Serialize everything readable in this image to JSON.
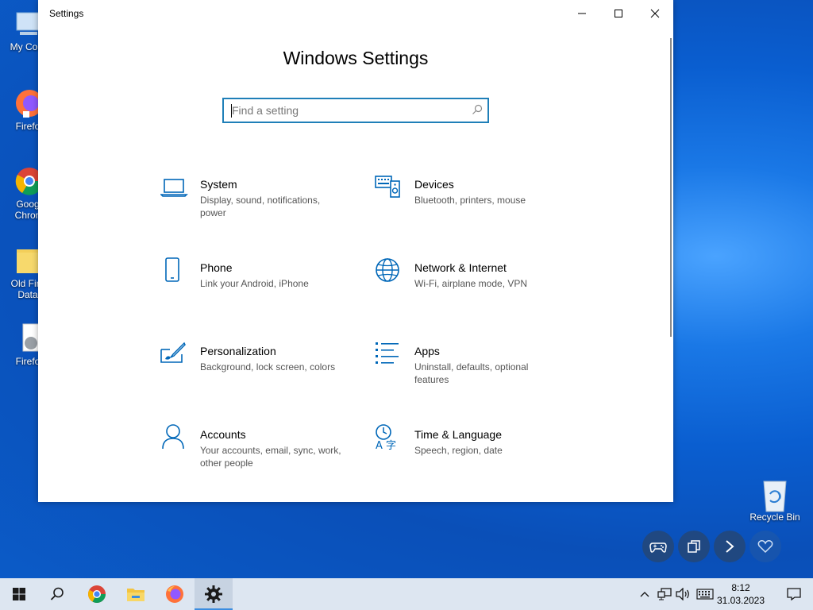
{
  "desktop": {
    "icons": [
      {
        "label": "My Com"
      },
      {
        "label": "Firefo"
      },
      {
        "label": "Goog\nChron"
      },
      {
        "label": "Old Fire\nData"
      },
      {
        "label": "Firefo"
      }
    ],
    "recycle_bin": "Recycle Bin"
  },
  "window": {
    "title": "Settings",
    "heading": "Windows Settings",
    "search_placeholder": "Find a setting",
    "categories": [
      {
        "name": "System",
        "desc": "Display, sound, notifications, power",
        "icon": "laptop-icon"
      },
      {
        "name": "Devices",
        "desc": "Bluetooth, printers, mouse",
        "icon": "keyboard-speaker-icon"
      },
      {
        "name": "Phone",
        "desc": "Link your Android, iPhone",
        "icon": "phone-icon"
      },
      {
        "name": "Network & Internet",
        "desc": "Wi-Fi, airplane mode, VPN",
        "icon": "globe-icon"
      },
      {
        "name": "Personalization",
        "desc": "Background, lock screen, colors",
        "icon": "paint-brush-icon"
      },
      {
        "name": "Apps",
        "desc": "Uninstall, defaults, optional features",
        "icon": "list-icon"
      },
      {
        "name": "Accounts",
        "desc": "Your accounts, email, sync, work, other people",
        "icon": "person-icon"
      },
      {
        "name": "Time & Language",
        "desc": "Speech, region, date",
        "icon": "time-language-icon"
      }
    ]
  },
  "taskbar": {
    "time": "8:12",
    "date": "31.03.2023"
  },
  "colors": {
    "accent": "#0067b8",
    "search_border": "#1f7fb8",
    "taskbar_bg": "#dde6f1"
  }
}
